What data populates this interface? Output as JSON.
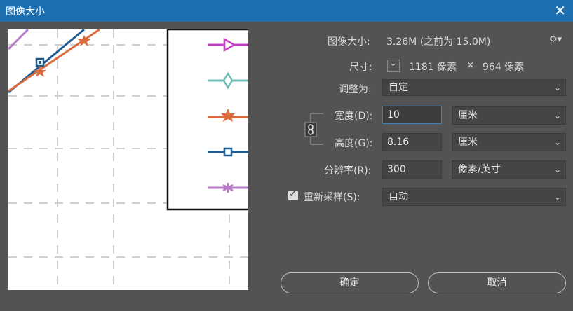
{
  "window": {
    "title": "图像大小",
    "close_glyph": "✕"
  },
  "image_size": {
    "label": "图像大小:",
    "value": "3.26M (之前为 15.0M)"
  },
  "settings_glyph": "⚙▾",
  "dimensions": {
    "label": "尺寸:",
    "width_value": "1181 像素",
    "times": "×",
    "height_value": "964 像素"
  },
  "fit_to": {
    "label": "调整为:",
    "value": "自定"
  },
  "width": {
    "label": "宽度(D):",
    "value": "10",
    "unit": "厘米"
  },
  "height": {
    "label": "高度(G):",
    "value": "8.16",
    "unit": "厘米"
  },
  "resolution": {
    "label": "分辨率(R):",
    "value": "300",
    "unit": "像素/英寸"
  },
  "resample": {
    "label": "重新采样(S):",
    "checked": true,
    "value": "自动"
  },
  "buttons": {
    "ok": "确定",
    "cancel": "取消"
  },
  "chevron": "⌄",
  "colors": {
    "titlebar": "#1e6fb0",
    "background": "#535353",
    "series_magenta": "#c23fc2",
    "series_teal": "#6fbdb5",
    "series_orange": "#d96b3f",
    "series_blue": "#1f5b8f",
    "series_lilac": "#b67ac6"
  }
}
